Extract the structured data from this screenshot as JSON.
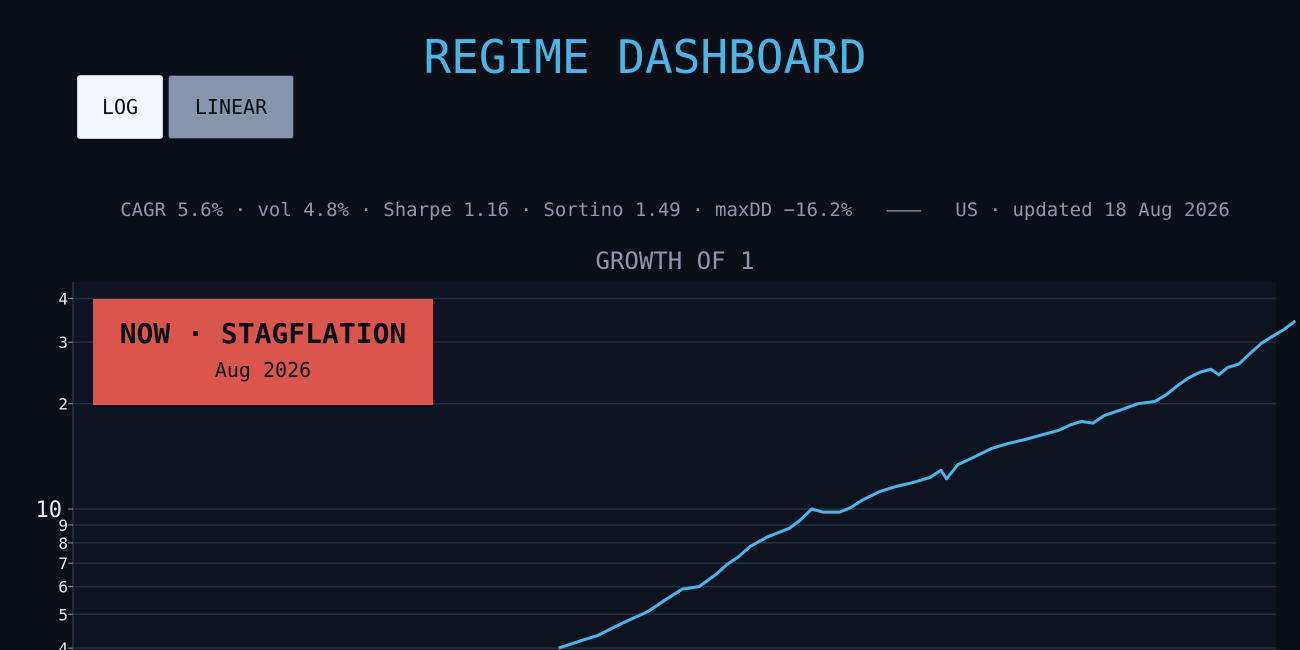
{
  "dashboard": {
    "title": "REGIME DASHBOARD"
  },
  "scale_toggle": {
    "log_label": "LOG",
    "linear_label": "LINEAR",
    "selected": "LOG"
  },
  "stats": {
    "metrics": "CAGR 5.6% · vol 4.8% · Sharpe 1.16 · Sortino 1.49 · maxDD −16.2%",
    "separator": "———",
    "meta": "US · updated 18 Aug 2026"
  },
  "regime_badge": {
    "title": "NOW · STAGFLATION",
    "date": "Aug 2026",
    "color": "#d9554e"
  },
  "colors": {
    "background": "#0a0e16",
    "plot_background": "#0e1320",
    "accent": "#4ab6e6",
    "muted_text": "#8e97aa",
    "gridline": "#252e40"
  },
  "chart_data": {
    "type": "line",
    "title": "GROWTH OF 1",
    "xlabel": "",
    "ylabel": "",
    "y_scale": "log",
    "grid": true,
    "y_tick_labels": [
      {
        "label": "4",
        "value": 40
      },
      {
        "label": "3",
        "value": 30
      },
      {
        "label": "2",
        "value": 20
      },
      {
        "label": "10",
        "value": 10
      },
      {
        "label": "9",
        "value": 9
      },
      {
        "label": "8",
        "value": 8
      },
      {
        "label": "7",
        "value": 7
      },
      {
        "label": "6",
        "value": 6
      },
      {
        "label": "5",
        "value": 5
      },
      {
        "label": "4",
        "value": 4
      }
    ],
    "series": [
      {
        "color": "#4ab6e6",
        "points": [
          [
            0.405,
            4.0
          ],
          [
            0.415,
            4.1
          ],
          [
            0.425,
            4.2
          ],
          [
            0.44,
            4.35
          ],
          [
            0.455,
            4.6
          ],
          [
            0.47,
            4.85
          ],
          [
            0.485,
            5.1
          ],
          [
            0.5,
            5.5
          ],
          [
            0.515,
            5.9
          ],
          [
            0.53,
            6.0
          ],
          [
            0.545,
            6.5
          ],
          [
            0.555,
            6.95
          ],
          [
            0.565,
            7.3
          ],
          [
            0.575,
            7.8
          ],
          [
            0.59,
            8.3
          ],
          [
            0.61,
            8.8
          ],
          [
            0.62,
            9.3
          ],
          [
            0.63,
            10.0
          ],
          [
            0.64,
            9.8
          ],
          [
            0.655,
            9.8
          ],
          [
            0.665,
            10.1
          ],
          [
            0.675,
            10.6
          ],
          [
            0.69,
            11.2
          ],
          [
            0.705,
            11.6
          ],
          [
            0.72,
            11.9
          ],
          [
            0.735,
            12.3
          ],
          [
            0.745,
            12.9
          ],
          [
            0.75,
            12.2
          ],
          [
            0.76,
            13.4
          ],
          [
            0.775,
            14.1
          ],
          [
            0.79,
            14.9
          ],
          [
            0.805,
            15.4
          ],
          [
            0.82,
            15.8
          ],
          [
            0.835,
            16.3
          ],
          [
            0.85,
            16.8
          ],
          [
            0.86,
            17.4
          ],
          [
            0.87,
            17.8
          ],
          [
            0.88,
            17.6
          ],
          [
            0.89,
            18.5
          ],
          [
            0.905,
            19.2
          ],
          [
            0.92,
            20.0
          ],
          [
            0.935,
            20.3
          ],
          [
            0.945,
            21.2
          ],
          [
            0.955,
            22.5
          ],
          [
            0.965,
            23.7
          ],
          [
            0.975,
            24.6
          ],
          [
            0.985,
            25.1
          ],
          [
            0.992,
            24.2
          ],
          [
            1.0,
            25.4
          ],
          [
            1.01,
            26.0
          ],
          [
            1.02,
            27.9
          ],
          [
            1.03,
            29.8
          ],
          [
            1.04,
            31.2
          ],
          [
            1.05,
            32.6
          ],
          [
            1.06,
            34.5
          ]
        ]
      }
    ],
    "x_range_note": "time axis not labeled in view"
  }
}
